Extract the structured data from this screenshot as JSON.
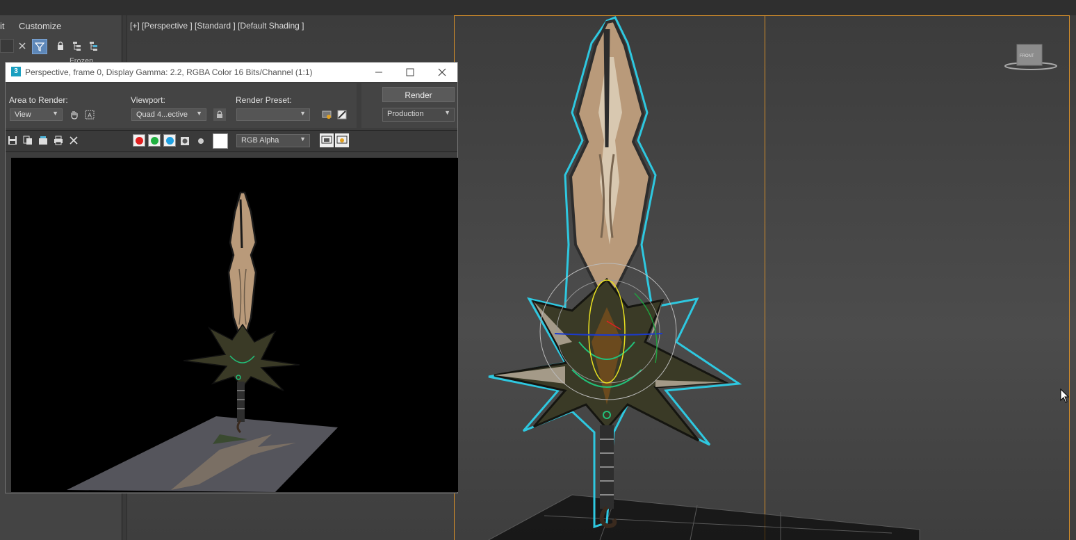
{
  "app": {
    "menu": [
      "it",
      "Customize"
    ],
    "frozen_label": "Frozen"
  },
  "viewport": {
    "label": "[+] [Perspective ] [Standard ] [Default Shading ]",
    "viewcube_label": "FRONT"
  },
  "frame_window": {
    "title": "Perspective, frame 0, Display Gamma: 2.2, RGBA Color 16 Bits/Channel (1:1)",
    "app_icon": "3",
    "area_to_render_label": "Area to Render:",
    "area_to_render_value": "View",
    "viewport_label": "Viewport:",
    "viewport_value": "Quad 4...ective",
    "render_preset_label": "Render Preset:",
    "render_preset_value": "",
    "render_button": "Render",
    "production_value": "Production",
    "channel_value": "RGB Alpha"
  },
  "colors": {
    "accent": "#5d87b8",
    "selection": "#2ec8e0",
    "safe_frame": "#d8902a",
    "red_channel": "#e02020",
    "green_channel": "#20b040",
    "blue_channel": "#20a0e0"
  }
}
